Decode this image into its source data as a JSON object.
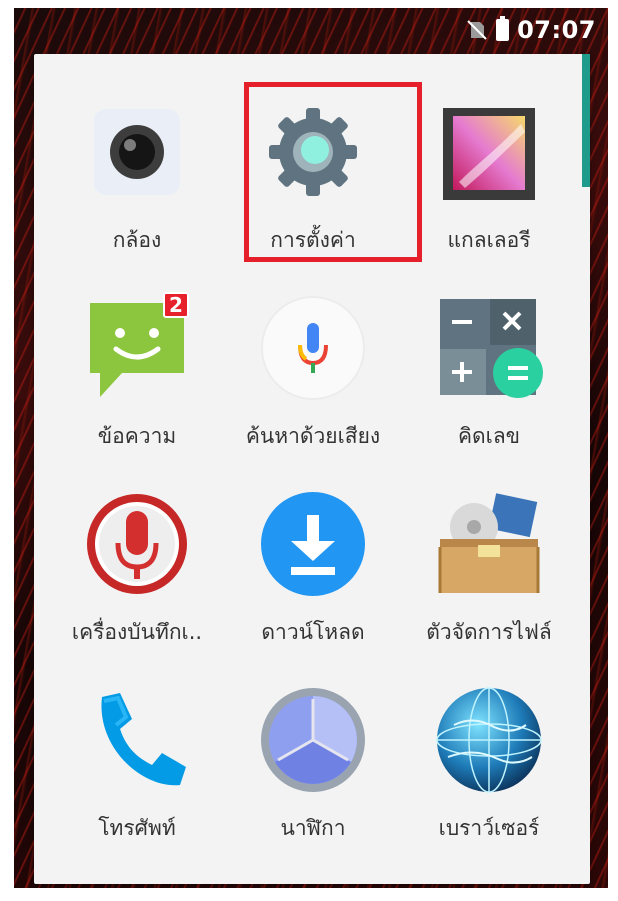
{
  "status_bar": {
    "time": "07:07",
    "icons": [
      "no-sim-icon",
      "battery-icon"
    ]
  },
  "app_drawer": {
    "apps": [
      {
        "label": "กล้อง",
        "icon": "camera-icon"
      },
      {
        "label": "การตั้งค่า",
        "icon": "settings-gear-icon",
        "highlighted": true
      },
      {
        "label": "แกลเลอรี",
        "icon": "gallery-icon"
      },
      {
        "label": "ข้อความ",
        "icon": "messages-icon",
        "badge": "2"
      },
      {
        "label": "ค้นหาด้วยเสียง",
        "icon": "voice-search-mic-icon"
      },
      {
        "label": "คิดเลข",
        "icon": "calculator-icon"
      },
      {
        "label": "เครื่องบันทึกเ..",
        "icon": "sound-recorder-icon"
      },
      {
        "label": "ดาวน์โหลด",
        "icon": "download-icon"
      },
      {
        "label": "ตัวจัดการไฟล์",
        "icon": "file-manager-icon"
      },
      {
        "label": "โทรศัพท์",
        "icon": "phone-icon"
      },
      {
        "label": "นาฬิกา",
        "icon": "clock-icon"
      },
      {
        "label": "เบราว์เซอร์",
        "icon": "browser-globe-icon"
      }
    ]
  },
  "colors": {
    "highlight_border": "#e5202b",
    "drawer_background": "#f3f3f3",
    "scroll_indicator": "#1f9b8c"
  }
}
